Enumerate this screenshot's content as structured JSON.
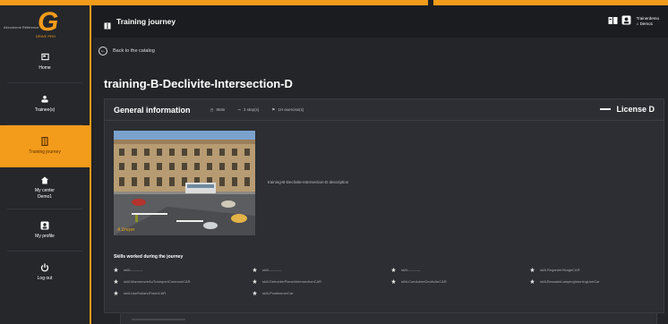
{
  "colors": {
    "accent": "#f39b1b",
    "background": "#1f2024",
    "card": "#2c2e33"
  },
  "brand": {
    "logo_letter": "G",
    "logo_sub": "DRIVE PRO",
    "small_text": "Aérodrome Référence"
  },
  "sidebar": {
    "items": [
      {
        "label": "Home",
        "icon": "home-icon"
      },
      {
        "label": "Trainee(s)",
        "icon": "trainees-icon"
      },
      {
        "label": "Training journey",
        "icon": "journey-icon"
      },
      {
        "label": "My center",
        "sublabel": "Demo1",
        "icon": "center-icon"
      },
      {
        "label": "My profile",
        "icon": "profile-icon"
      },
      {
        "label": "Log out",
        "icon": "power-icon"
      }
    ]
  },
  "header": {
    "title": "Training journey",
    "user_name": "Trainerdemo",
    "user_center": "Demo1"
  },
  "back": {
    "label": "Back to the catalog"
  },
  "page": {
    "title": "training-B-Declivite-Intersection-D"
  },
  "card": {
    "title": "General information",
    "meta": {
      "duration": "8Min",
      "steps": "3 step(s)",
      "exercises": "1H exercise(s)"
    },
    "license": "License D",
    "description": "training-B-Declivite-Intersection-D description",
    "thumbnail_caption": "A.Dreyer"
  },
  "skills": {
    "title": "Skills worked during the journey",
    "items": [
      "skill-----------",
      "skill-----------",
      "skill-----------",
      "skill-RegarderVirageCAR",
      "skill-ManoeuvreAuTransportCommunCAR",
      "skill-DeborderPlanchIntersectionCAR",
      "skill-ConduireeDeclivAeCAR",
      "skill-BessaintLampingIntoningUseCar",
      "skill-UseRollandTrachCAR",
      "skill-PositionnerCar"
    ]
  }
}
